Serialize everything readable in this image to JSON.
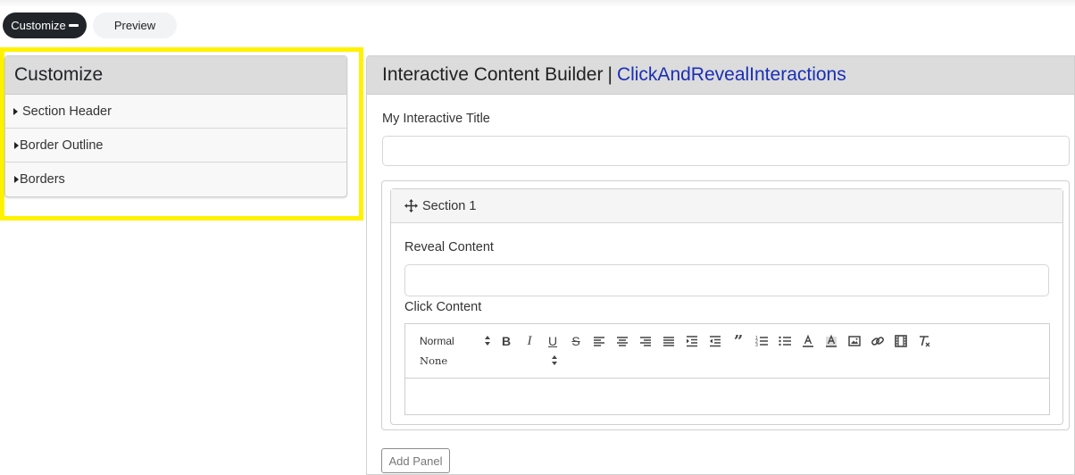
{
  "mode_switch": {
    "customize_label": "Customize",
    "preview_label": "Preview"
  },
  "customize_panel": {
    "title": "Customize",
    "items": [
      {
        "label": "Section Header"
      },
      {
        "label": "Border Outline"
      },
      {
        "label": "Borders"
      }
    ]
  },
  "builder": {
    "title": "Interactive Content Builder",
    "separator": "|",
    "type_name": "ClickAndRevealInteractions",
    "title_field_label": "My Interactive Title",
    "title_field_value": "",
    "section": {
      "name": "Section 1",
      "reveal_label": "Reveal Content",
      "reveal_value": "",
      "click_label": "Click Content",
      "editor": {
        "format_select": "Normal",
        "font_select": "None",
        "tools": [
          "bold",
          "italic",
          "underline",
          "strike",
          "align-left",
          "align-center",
          "align-right",
          "align-justify",
          "indent",
          "outdent",
          "blockquote",
          "ordered-list",
          "bullet-list",
          "text-color",
          "background-color",
          "image",
          "link",
          "video",
          "clear-format"
        ]
      }
    },
    "add_panel_label": "Add Panel"
  },
  "colors": {
    "highlight": "#fff200",
    "type_name": "#1a2fb5",
    "dark_button": "#212529"
  }
}
